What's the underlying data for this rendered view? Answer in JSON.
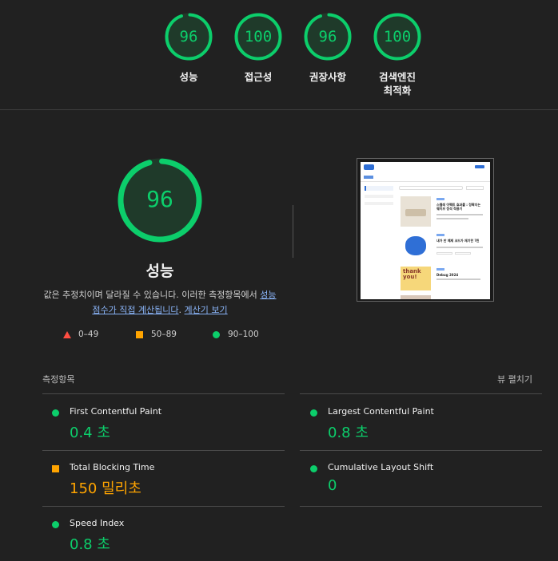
{
  "categories": [
    {
      "score": "96",
      "label": "성능",
      "progress": 0.96
    },
    {
      "score": "100",
      "label": "접근성",
      "progress": 1.0
    },
    {
      "score": "96",
      "label": "권장사항",
      "progress": 0.96
    },
    {
      "score": "100",
      "label": "검색엔진 최적화",
      "label_line1": "검색엔진",
      "label_line2": "최적화",
      "progress": 1.0
    }
  ],
  "main": {
    "score": "96",
    "progress": 0.96,
    "title": "성능",
    "desc_text": "값은 추정치이며 달라질 수 있습니다. 이러한 측정항목에서 ",
    "desc_link1a": "성능",
    "desc_link1b": "점수가 직접 계산됩니다",
    "desc_sep": ". ",
    "desc_link2": "계산기 보기"
  },
  "legend": {
    "fail": "0–49",
    "average": "50–89",
    "pass": "90–100"
  },
  "metrics": {
    "heading": "측정항목",
    "expand_label": "뷰 펼치기",
    "items": [
      {
        "name": "First Contentful Paint",
        "value": "0.4 초",
        "status": "pass"
      },
      {
        "name": "Largest Contentful Paint",
        "value": "0.8 초",
        "status": "pass"
      },
      {
        "name": "Total Blocking Time",
        "value": "150 밀리초",
        "status": "average"
      },
      {
        "name": "Cumulative Layout Shift",
        "value": "0",
        "status": "pass"
      },
      {
        "name": "Speed Index",
        "value": "0.8 초",
        "status": "pass"
      }
    ]
  },
  "colors": {
    "pass": "#0cce6b",
    "average": "#ffa400",
    "fail": "#ff4e42",
    "background": "#212121",
    "link": "#8ab4f8"
  },
  "thumbnail": {
    "post1_title": "스켈레 이펙트 효과를 : 정확지는 웨이브 정석 적용기",
    "post2_title": "내가 만 예제 코드가 재기한 ?린",
    "post3_title": "Debug 2024",
    "thank_you_line1": "thank",
    "thank_you_line2": "you!"
  }
}
